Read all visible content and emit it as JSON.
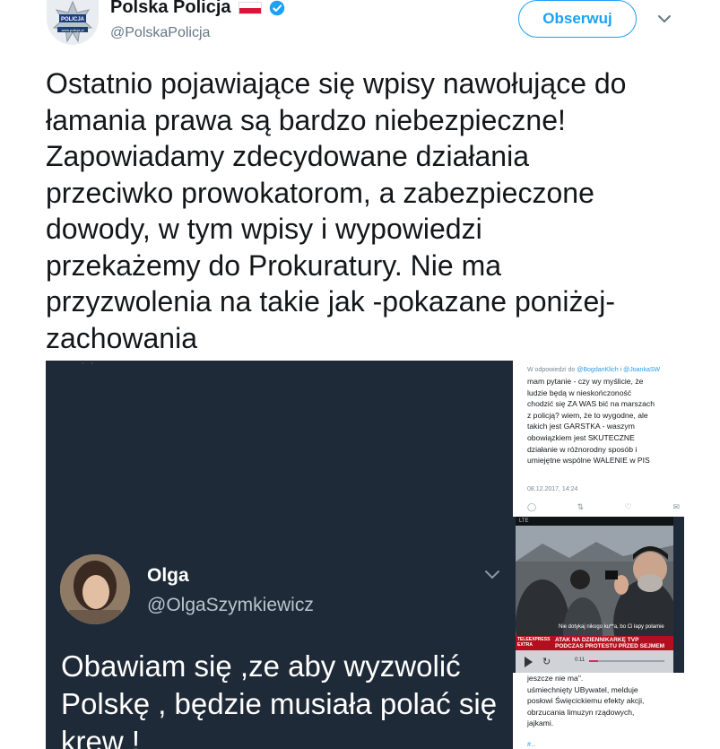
{
  "account": {
    "name": "Polska Policja",
    "handle": "@PolskaPolicja",
    "badge_text": "POLICJA",
    "badge_url": "www.policja.pl"
  },
  "follow_label": "Obserwuj",
  "tweet": {
    "text": "Ostatnio pojawiające się wpisy nawołujące do\nłamania prawa są bardzo niebezpieczne!\nZapowiadamy zdecydowane działania\nprzeciwko prowokatorom, a zabezpieczone\ndowody, w tym wpisy i wypowiedzi\nprzekażemy do Prokuratury. Nie ma\nprzyzwolenia na takie jak -pokazane poniżej-\nzachowania"
  },
  "embed_left": {
    "name": "Olga",
    "handle": "@OlgaSzymkiewicz",
    "text": "Obawiam się ,ze aby wyzwolić\nPolskę , będzie musiała polać się\nkrew !"
  },
  "embed_right_top": {
    "reply_prefix": "W odpowiedzi do",
    "mention_1": "@BogdanKlich",
    "reply_and": "i",
    "mention_2": "@JoankaSW",
    "text": "mam pytanie - czy wy myślicie, że\nludzie będą w nieskończoność\nchodzić się ZA WAS bić na marszach\nz policją? wiem, że to wygodne, ale\ntakich jest GARSTKA - waszym\nobowiązkiem jest SKUTECZNE\ndziałanie w różnorodny sposób i\numiejętne wspólne WALENIE w PIS",
    "date": "08.12.2017, 14:24"
  },
  "embed_video": {
    "status": "LTE",
    "caption": "Nie dotykaj nikogo ku**a, bo Ci łapy połamie",
    "logo": "TELEEXPRESS EXTRA",
    "title": "ATAK NA DZIENNIKARKĘ TVP\nPODCZAS PROTESTU PRZED SEJMEM",
    "time": "0:11",
    "progress": 0.12
  },
  "embed_right_bottom": {
    "text": "jeszcze nie ma\".\nuśmiechnięty UBywatel, melduje\nposłowi Święcickiemu efekty akcji,\nobrzucania limuzyn rządowych,\njajkami.",
    "tag": "#..."
  },
  "colors": {
    "accent": "#1da1f2",
    "text": "#14171a",
    "muted": "#657786",
    "flag_red": "#dc143c",
    "dark_bg": "#1e2a37"
  },
  "icons": {
    "verified": "verified-badge-icon",
    "caret": "chevron-down-icon",
    "flag": "poland-flag-icon"
  }
}
